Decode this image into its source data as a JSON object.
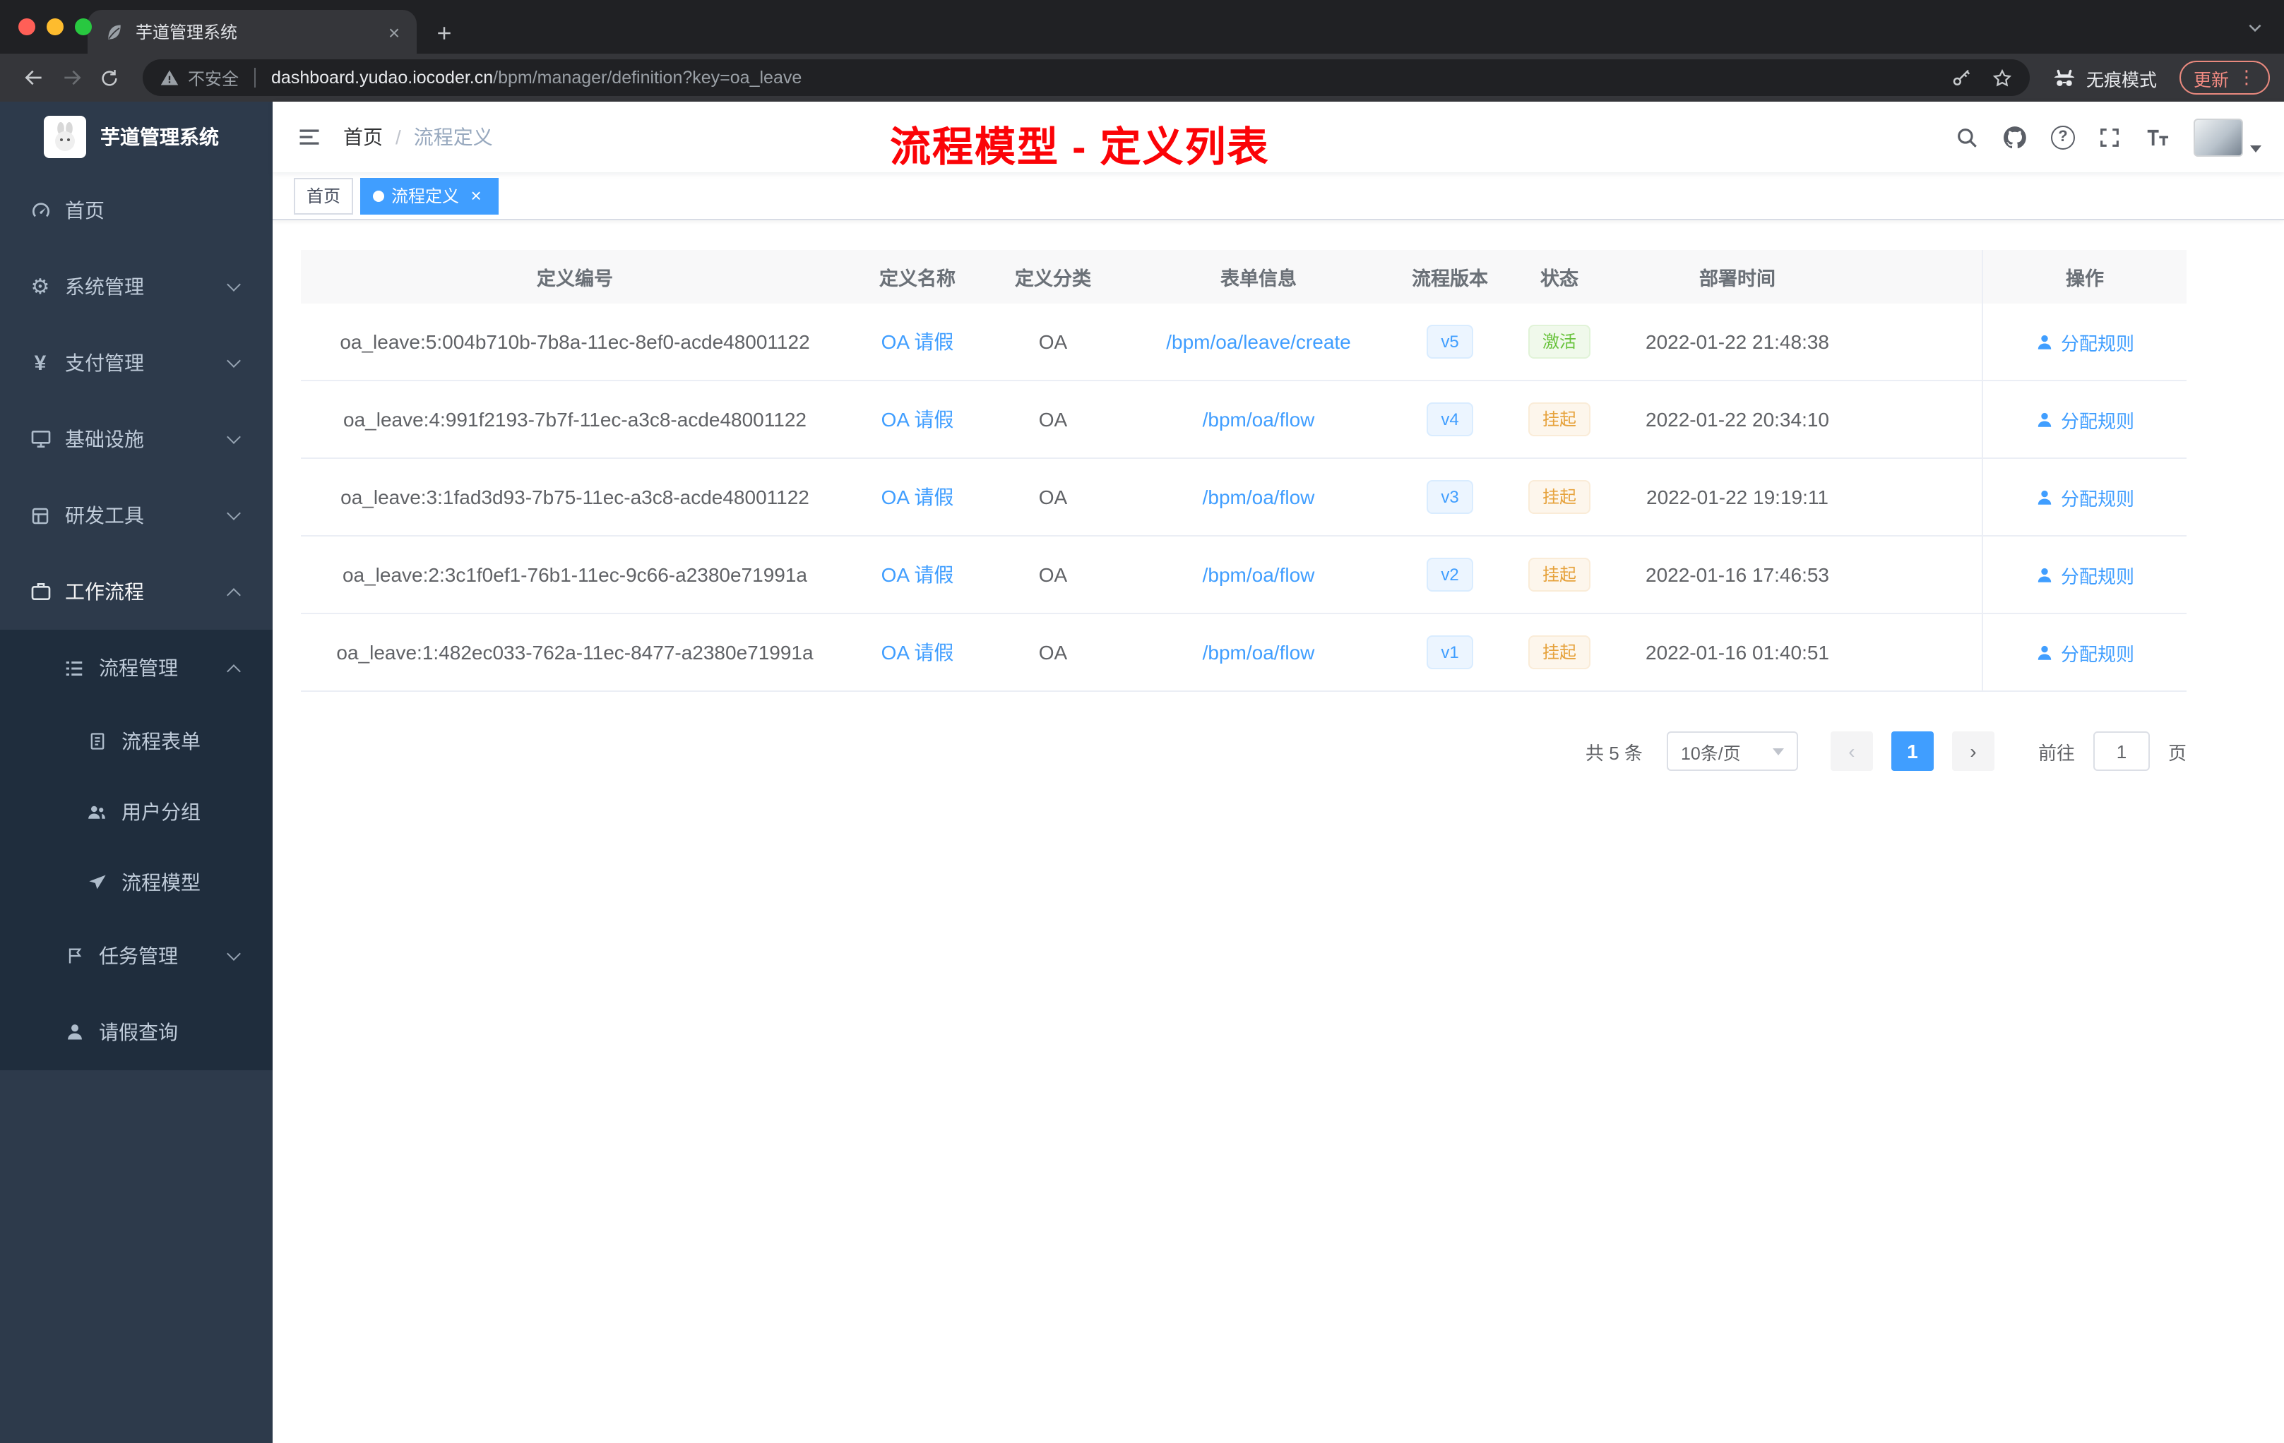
{
  "browser": {
    "tab_title": "芋道管理系统",
    "security_label": "不安全",
    "url_domain": "dashboard.yudao.iocoder.cn",
    "url_path": "/bpm/manager/definition?key=oa_leave",
    "incognito_label": "无痕模式",
    "update_label": "更新"
  },
  "sidebar": {
    "logo_title": "芋道管理系统",
    "home": "首页",
    "system": "系统管理",
    "payment": "支付管理",
    "infrastructure": "基础设施",
    "devtools": "研发工具",
    "workflow": "工作流程",
    "process_mgmt": "流程管理",
    "process_form": "流程表单",
    "user_group": "用户分组",
    "process_model": "流程模型",
    "task_mgmt": "任务管理",
    "leave_query": "请假查询"
  },
  "header": {
    "breadcrumb_home": "首页",
    "breadcrumb_sep": "/",
    "breadcrumb_current": "流程定义",
    "annotation": "流程模型 - 定义列表"
  },
  "tags_view": {
    "home": "首页",
    "active": "流程定义"
  },
  "table": {
    "columns": [
      "定义编号",
      "定义名称",
      "定义分类",
      "表单信息",
      "流程版本",
      "状态",
      "部署时间",
      "操作"
    ],
    "action_label": "分配规则",
    "rows": [
      {
        "id": "oa_leave:5:004b710b-7b8a-11ec-8ef0-acde48001122",
        "name": "OA 请假",
        "category": "OA",
        "form": "/bpm/oa/leave/create",
        "version": "v5",
        "status": "激活",
        "status_type": "success",
        "time": "2022-01-22 21:48:38"
      },
      {
        "id": "oa_leave:4:991f2193-7b7f-11ec-a3c8-acde48001122",
        "name": "OA 请假",
        "category": "OA",
        "form": "/bpm/oa/flow",
        "version": "v4",
        "status": "挂起",
        "status_type": "warning",
        "time": "2022-01-22 20:34:10"
      },
      {
        "id": "oa_leave:3:1fad3d93-7b75-11ec-a3c8-acde48001122",
        "name": "OA 请假",
        "category": "OA",
        "form": "/bpm/oa/flow",
        "version": "v3",
        "status": "挂起",
        "status_type": "warning",
        "time": "2022-01-22 19:19:11"
      },
      {
        "id": "oa_leave:2:3c1f0ef1-76b1-11ec-9c66-a2380e71991a",
        "name": "OA 请假",
        "category": "OA",
        "form": "/bpm/oa/flow",
        "version": "v2",
        "status": "挂起",
        "status_type": "warning",
        "time": "2022-01-16 17:46:53"
      },
      {
        "id": "oa_leave:1:482ec033-762a-11ec-8477-a2380e71991a",
        "name": "OA 请假",
        "category": "OA",
        "form": "/bpm/oa/flow",
        "version": "v1",
        "status": "挂起",
        "status_type": "warning",
        "time": "2022-01-16 01:40:51"
      }
    ]
  },
  "pagination": {
    "total": "共 5 条",
    "page_size": "10条/页",
    "page": "1",
    "goto": "前往",
    "goto_value": "1",
    "unit": "页"
  },
  "icons": {
    "close": "×",
    "kebab": "⋮",
    "prev": "‹",
    "next": "›",
    "gear": "⚙",
    "yen": "¥"
  },
  "colors": {
    "accent": "#409eff",
    "success": "#67c23a",
    "warning": "#e6a23c",
    "annotation_red": "#fb0307",
    "sidebar_bg": "#2d3a4b",
    "submenu_bg": "#1f2d3d"
  }
}
